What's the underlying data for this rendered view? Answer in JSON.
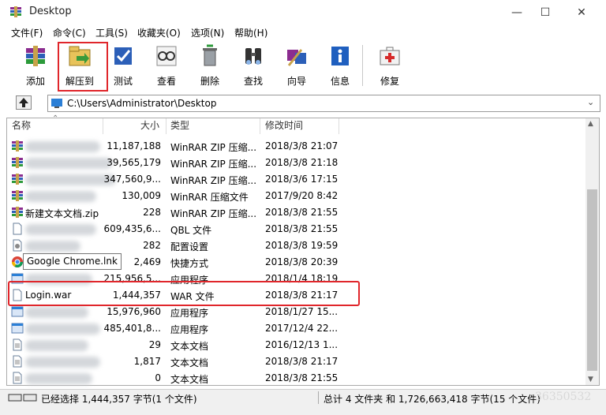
{
  "window": {
    "title": "Desktop"
  },
  "menu": [
    "文件(F)",
    "命令(C)",
    "工具(S)",
    "收藏夹(O)",
    "选项(N)",
    "帮助(H)"
  ],
  "toolbar": [
    {
      "label": "添加",
      "icon": "add-archive-icon"
    },
    {
      "label": "解压到",
      "icon": "extract-to-icon"
    },
    {
      "label": "测试",
      "icon": "test-icon"
    },
    {
      "label": "查看",
      "icon": "view-icon"
    },
    {
      "label": "删除",
      "icon": "delete-icon"
    },
    {
      "label": "查找",
      "icon": "find-icon"
    },
    {
      "label": "向导",
      "icon": "wizard-icon"
    },
    {
      "label": "信息",
      "icon": "info-icon"
    },
    {
      "label": "修复",
      "icon": "repair-icon"
    }
  ],
  "address": {
    "path": "C:\\Users\\Administrator\\Desktop"
  },
  "columns": {
    "name": "名称",
    "size": "大小",
    "type": "类型",
    "modified": "修改时间"
  },
  "files": [
    {
      "name": "",
      "size": "11,187,188",
      "type": "WinRAR ZIP 压缩...",
      "modified": "2018/3/8 21:07",
      "icon": "rar-icon"
    },
    {
      "name": "",
      "size": "39,565,179",
      "type": "WinRAR ZIP 压缩...",
      "modified": "2018/3/8 21:18",
      "icon": "rar-icon"
    },
    {
      "name": "",
      "size": "347,560,9...",
      "type": "WinRAR ZIP 压缩...",
      "modified": "2018/3/6 17:15",
      "icon": "rar-icon"
    },
    {
      "name": "",
      "size": "130,009",
      "type": "WinRAR 压缩文件",
      "modified": "2017/9/20 8:42",
      "icon": "rar-icon"
    },
    {
      "name": "新建文本文档.zip",
      "size": "228",
      "type": "WinRAR ZIP 压缩...",
      "modified": "2018/3/8 21:55",
      "icon": "rar-icon"
    },
    {
      "name": "",
      "size": "609,435,6...",
      "type": "QBL 文件",
      "modified": "2018/3/8 21:55",
      "icon": "file-icon"
    },
    {
      "name": "",
      "size": "282",
      "type": "配置设置",
      "modified": "2018/3/8 19:59",
      "icon": "settings-file-icon"
    },
    {
      "name": "",
      "size": "2,469",
      "type": "快捷方式",
      "modified": "2018/3/8 20:39",
      "icon": "chrome-icon"
    },
    {
      "name": "",
      "size": "215,956,5...",
      "type": "应用程序",
      "modified": "2018/1/4 18:19",
      "icon": "app-icon"
    },
    {
      "name": "Login.war",
      "size": "1,444,357",
      "type": "WAR 文件",
      "modified": "2018/3/8 21:17",
      "icon": "file-icon"
    },
    {
      "name": "",
      "size": "15,976,960",
      "type": "应用程序",
      "modified": "2018/1/27 15...",
      "icon": "app-icon"
    },
    {
      "name": "",
      "size": "485,401,8...",
      "type": "应用程序",
      "modified": "2017/12/4 22...",
      "icon": "app-icon"
    },
    {
      "name": "",
      "size": "29",
      "type": "文本文档",
      "modified": "2016/12/13 1...",
      "icon": "text-file-icon"
    },
    {
      "name": "",
      "size": "1,817",
      "type": "文本文档",
      "modified": "2018/3/8 21:17",
      "icon": "text-file-icon"
    },
    {
      "name": "",
      "size": "0",
      "type": "文本文档",
      "modified": "2018/3/8 21:55",
      "icon": "text-file-icon"
    }
  ],
  "tooltip": "Google Chrome.lnk",
  "status": {
    "left": "已经选择 1,444,357 字节(1 个文件)",
    "right": "总计 4 文件夹 和 1,726,663,418 字节(15 个文件)",
    "watermark": "36350532"
  },
  "colors": {
    "highlight": "#e0262b"
  }
}
